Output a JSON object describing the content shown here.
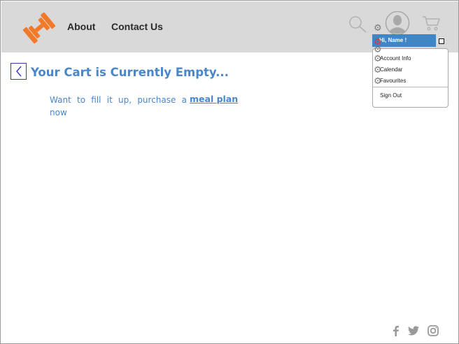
{
  "nav": {
    "about": "About",
    "contact": "Contact Us"
  },
  "header": {
    "logo_icon": "dumbbell-icon",
    "search_icon": "search-icon",
    "avatar_icon": "user-avatar-icon",
    "cart_icon": "cart-icon"
  },
  "user_menu": {
    "greeting": "Hi, Name !",
    "items": [
      {
        "label": "Account Info"
      },
      {
        "label": "Calendar"
      },
      {
        "label": "Favourites"
      }
    ],
    "sign_out": "Sign Out"
  },
  "cart": {
    "title": "Your Cart is Currently Empty...",
    "cta_text": "Want to fill it up, purchase a now",
    "cta_link": "meal plan"
  },
  "footer": {
    "social_icons": [
      "facebook-icon",
      "twitter-icon",
      "instagram-icon"
    ]
  },
  "colors": {
    "header_bg": "#d9d9d9",
    "accent_blue": "#4a86c8",
    "dropdown_blue": "#3f86c6",
    "logo_orange": "#f07a2a",
    "icon_gray": "#9a9a9a"
  }
}
